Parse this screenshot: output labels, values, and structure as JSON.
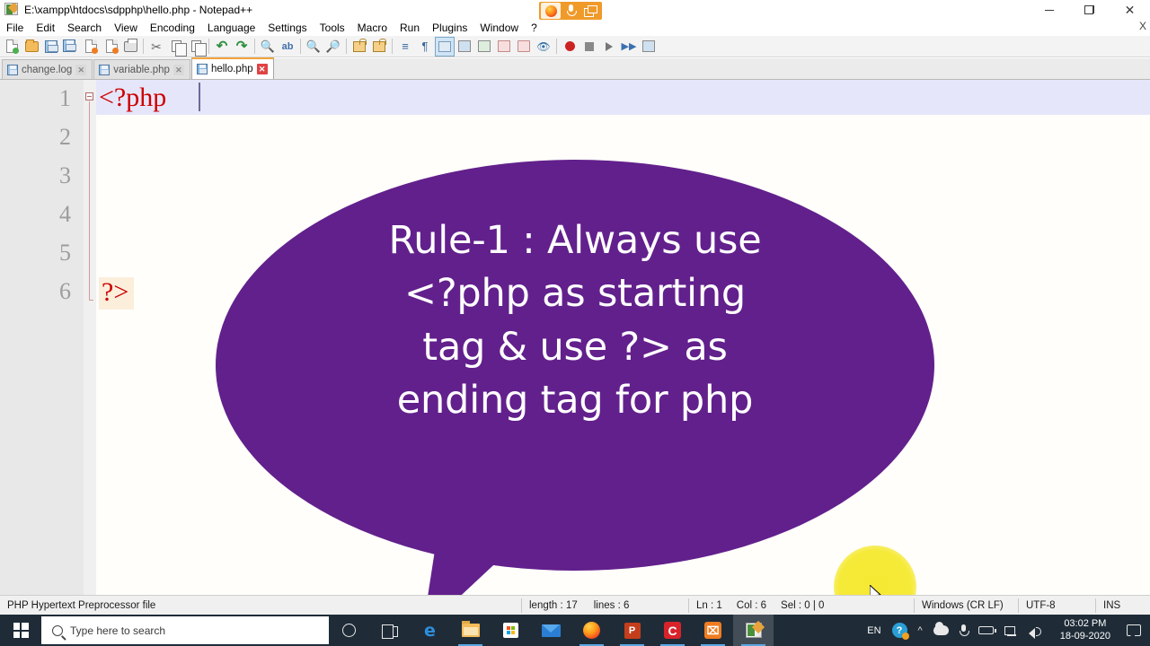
{
  "window": {
    "title": "E:\\xampp\\htdocs\\sdpphp\\hello.php - Notepad++",
    "icon": "notepad-plus-plus-icon",
    "minimize_label": "",
    "restore_label": "",
    "close_label": "✕",
    "tab_close_hint": "X"
  },
  "recording_toolbar": {
    "items": [
      {
        "name": "firefox-sharing-icon",
        "label": ""
      },
      {
        "name": "microphone-icon",
        "label": ""
      },
      {
        "name": "screen-share-icon",
        "label": ""
      }
    ],
    "background_color": "#f09a2a"
  },
  "menu": {
    "items": [
      "File",
      "Edit",
      "Search",
      "View",
      "Encoding",
      "Language",
      "Settings",
      "Tools",
      "Macro",
      "Run",
      "Plugins",
      "Window",
      "?"
    ]
  },
  "toolbar": {
    "buttons": [
      "new-file-icon",
      "open-file-icon",
      "save-icon",
      "save-all-icon",
      "close-file-icon",
      "close-all-icon",
      "print-icon",
      "cut-icon",
      "copy-icon",
      "paste-icon",
      "undo-icon",
      "redo-icon",
      "find-icon",
      "replace-icon",
      "zoom-in-icon",
      "zoom-out-icon",
      "sync-vertical-scroll-icon",
      "sync-horizontal-scroll-icon",
      "word-wrap-icon",
      "show-all-characters-icon",
      "indent-guide-icon",
      "user-defined-dialog-icon",
      "show-document-map-icon",
      "function-list-icon",
      "folder-as-workspace-icon",
      "monitoring-icon",
      "record-macro-icon",
      "stop-record-macro-icon",
      "play-macro-icon",
      "run-macro-multiple-icon",
      "save-macro-icon"
    ]
  },
  "tabs": [
    {
      "label": "change.log",
      "active": false,
      "close_label": "✕"
    },
    {
      "label": "variable.php",
      "active": false,
      "close_label": "✕"
    },
    {
      "label": "hello.php",
      "active": true,
      "close_label": "✕"
    }
  ],
  "editor": {
    "line_numbers": [
      "1",
      "2",
      "3",
      "4",
      "5",
      "6"
    ],
    "lines": [
      {
        "number": "1",
        "text": "<?php",
        "current": true
      },
      {
        "number": "2",
        "text": "",
        "current": false
      },
      {
        "number": "3",
        "text": "",
        "current": false
      },
      {
        "number": "4",
        "text": "",
        "current": false
      },
      {
        "number": "5",
        "text": "",
        "current": false
      },
      {
        "number": "6",
        "text": "?>",
        "current": false
      }
    ],
    "code_color": "#cc0000",
    "current_line_highlight": "#e6e6fa",
    "brace_highlight": "#fbeedb"
  },
  "callout": {
    "text_lines": [
      "Rule-1 : Always use",
      "<?php as starting",
      "tag & use ?> as",
      "ending tag for php"
    ],
    "background_color": "#62208c",
    "text_color": "#ffffff"
  },
  "statusbar": {
    "file_type": "PHP Hypertext Preprocessor file",
    "length_label": "length : 17",
    "lines_label": "lines : 6",
    "ln_label": "Ln : 1",
    "col_label": "Col : 6",
    "sel_label": "Sel : 0 | 0",
    "eol": "Windows (CR LF)",
    "encoding": "UTF-8",
    "insert_mode": "INS"
  },
  "taskbar": {
    "start_label": "",
    "search_placeholder": "Type here to search",
    "items": [
      {
        "name": "cortana-icon",
        "label": ""
      },
      {
        "name": "task-view-icon",
        "label": ""
      },
      {
        "name": "edge-icon",
        "label": "e"
      },
      {
        "name": "file-explorer-icon",
        "label": ""
      },
      {
        "name": "microsoft-store-icon",
        "label": ""
      },
      {
        "name": "mail-icon",
        "label": ""
      },
      {
        "name": "firefox-icon",
        "label": ""
      },
      {
        "name": "powerpoint-icon",
        "label": "P"
      },
      {
        "name": "camtasia-icon",
        "label": "C"
      },
      {
        "name": "xampp-icon",
        "label": "⌧"
      },
      {
        "name": "notepad-plus-plus-taskbar-icon",
        "label": ""
      }
    ],
    "tray": {
      "language": "EN",
      "help_icon_label": "?",
      "time": "03:02 PM",
      "date": "18-09-2020"
    }
  }
}
